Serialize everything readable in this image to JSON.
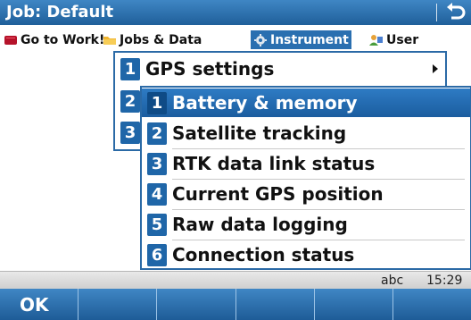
{
  "window": {
    "title": "Job: Default",
    "back_icon": "return-arrow-icon"
  },
  "menubar": {
    "items": [
      {
        "label": "Go to Work!",
        "icon": "book-icon",
        "active": false
      },
      {
        "label": "Jobs & Data",
        "icon": "folder-icon",
        "active": false
      },
      {
        "label": "Instrument",
        "icon": "gear-icon",
        "active": true
      },
      {
        "label": "User",
        "icon": "user-icon",
        "active": false
      }
    ]
  },
  "instrument_menu": {
    "items": [
      {
        "number": "1",
        "label": "GPS settings",
        "has_submenu": true
      },
      {
        "number": "2",
        "label": "",
        "has_submenu": false
      },
      {
        "number": "3",
        "label": "",
        "has_submenu": false
      }
    ]
  },
  "gps_submenu": {
    "items": [
      {
        "number": "1",
        "label": "Battery & memory",
        "selected": true
      },
      {
        "number": "2",
        "label": "Satellite tracking",
        "selected": false
      },
      {
        "number": "3",
        "label": "RTK data link status",
        "selected": false
      },
      {
        "number": "4",
        "label": "Current GPS position",
        "selected": false
      },
      {
        "number": "5",
        "label": "Raw data logging",
        "selected": false
      },
      {
        "number": "6",
        "label": "Connection status",
        "selected": false
      }
    ]
  },
  "statusbar": {
    "input_mode": "abc",
    "time": "15:29"
  },
  "softkeys": {
    "keys": [
      "OK",
      "",
      "",
      "",
      "",
      ""
    ]
  },
  "colors": {
    "accent": "#2a6fb0",
    "selection": "#1f66a8"
  }
}
